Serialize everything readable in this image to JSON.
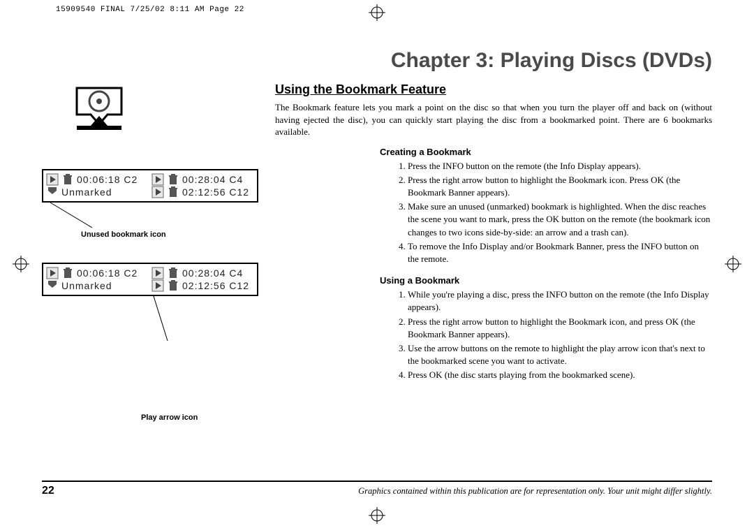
{
  "crop_header": "15909540 FINAL  7/25/02  8:11 AM  Page 22",
  "chapter_title": "Chapter 3: Playing Discs (DVDs)",
  "section_heading": "Using the Bookmark Feature",
  "intro_text": "The Bookmark feature lets you mark a point on the disc so that when you turn the player off and back on (without having ejected the disc), you can quickly start playing the disc from a bookmarked point. There are 6 bookmarks available.",
  "create": {
    "title": "Creating a Bookmark",
    "steps": [
      "Press the INFO button on the remote (the Info Display appears).",
      "Press the right arrow button to highlight the Bookmark icon. Press OK (the Bookmark Banner appears).",
      "Make sure an unused (unmarked) bookmark is highlighted. When the disc reaches the scene you want to mark, press the OK button on the remote (the bookmark icon changes to two icons side-by-side: an arrow and a trash can).",
      "To remove the Info Display and/or Bookmark Banner, press the INFO button on the remote."
    ]
  },
  "use": {
    "title": "Using a Bookmark",
    "steps": [
      "While you're playing a disc, press the INFO button on the remote (the Info Display appears).",
      "Press the right arrow button to highlight the Bookmark icon, and press OK (the Bookmark Banner appears).",
      "Use the arrow buttons on the remote to highlight the play arrow icon that's next to the bookmarked scene you want to activate.",
      "Press OK (the disc starts playing from the bookmarked scene)."
    ]
  },
  "banner": {
    "r1c1_time": "00:06:18",
    "r1c1_chap": "C2",
    "r1c2_time": "00:28:04",
    "r1c2_chap": "C4",
    "r2c1_label": "Unmarked",
    "r2c2_time": "02:12:56",
    "r2c2_chap": "C12"
  },
  "captions": {
    "unused": "Unused bookmark icon",
    "play": "Play arrow icon"
  },
  "page_number": "22",
  "footer_note": "Graphics contained within this publication are for representation only. Your unit might differ slightly."
}
